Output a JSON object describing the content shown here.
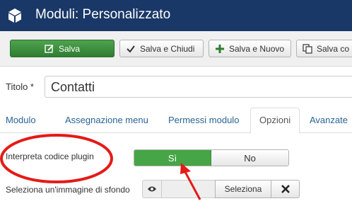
{
  "header": {
    "title": "Moduli: Personalizzato",
    "icon": "cube-icon"
  },
  "toolbar": {
    "save_label": "Salva",
    "save_close_label": "Salva e Chiudi",
    "save_new_label": "Salva e Nuovo",
    "save_copy_label": "Salva co"
  },
  "form": {
    "title_label": "Titolo *",
    "title_value": "Contatti"
  },
  "tabs": [
    {
      "label": "Modulo"
    },
    {
      "label": "Assegnazione menu"
    },
    {
      "label": "Permessi modulo"
    },
    {
      "label": "Opzioni",
      "active": true
    },
    {
      "label": "Avanzate"
    }
  ],
  "options": {
    "plugin_label": "Interpreta codice plugin",
    "yes_label": "Sì",
    "no_label": "No",
    "selected": "Sì",
    "bg_image_label": "Seleziona un'immagine di sfondo",
    "select_button": "Seleziona"
  },
  "colors": {
    "header_bg": "#1a3867",
    "save_green": "#2f7d32",
    "toggle_green": "#46a546",
    "annotation_red": "#e41b17"
  }
}
